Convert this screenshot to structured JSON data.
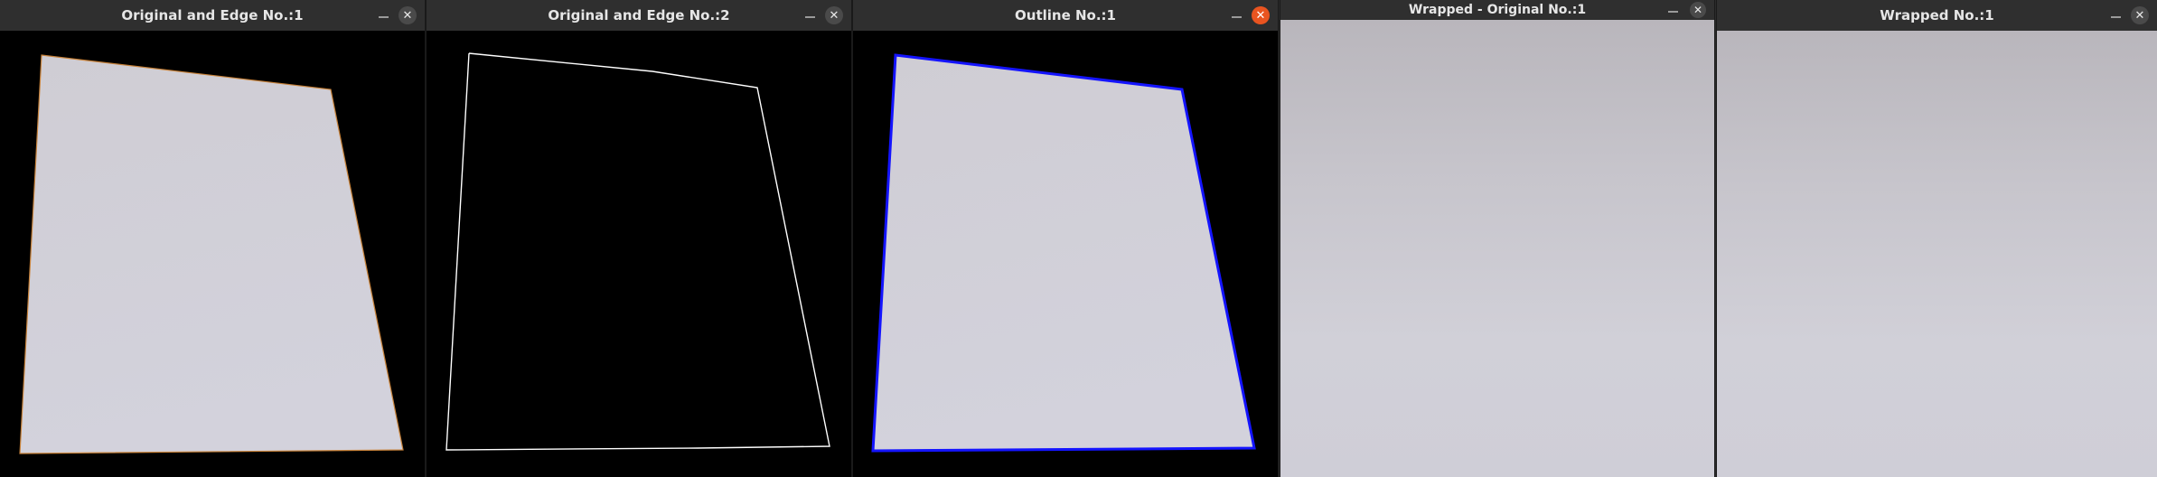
{
  "windows": [
    {
      "title": "Original and Edge No.:1",
      "close_symbol": "✕",
      "close_active": false
    },
    {
      "title": "Original and Edge No.:2",
      "close_symbol": "✕",
      "close_active": false
    },
    {
      "title": "Outline No.:1",
      "close_symbol": "✕",
      "close_active": true
    },
    {
      "title": "Wrapped - Original No.:1",
      "close_symbol": "✕",
      "close_active": false
    },
    {
      "title": "Wrapped No.:1",
      "close_symbol": "✕",
      "close_active": false
    }
  ],
  "colors": {
    "titlebar": "#2f2f2f",
    "close_active": "#e95420",
    "edge_line": "#ffffff",
    "outline": "#1414ff",
    "paper": "#cfced6"
  }
}
